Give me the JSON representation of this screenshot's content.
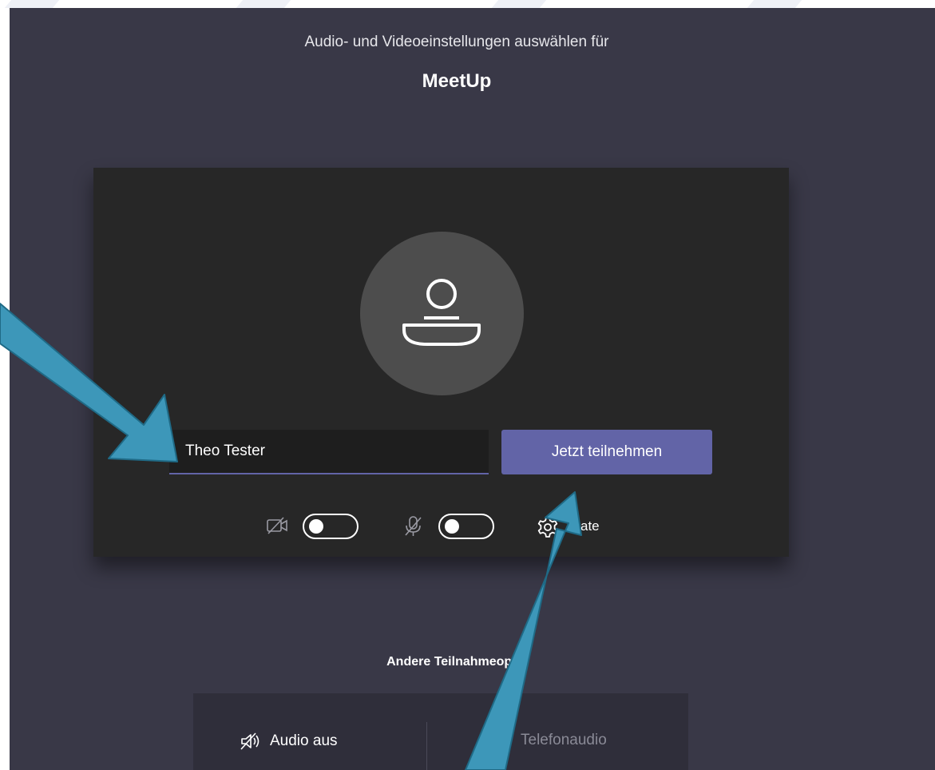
{
  "header": {
    "subtitle": "Audio- und Videoeinstellungen auswählen für",
    "meeting_name": "MeetUp"
  },
  "prejoin": {
    "name_value": "Theo Tester",
    "join_label": "Jetzt teilnehmen",
    "video_toggle": "off",
    "mic_toggle": "off",
    "devices_label": "Geräte",
    "devices_label_visible": "ate"
  },
  "other_options": {
    "title": "Andere Teilnahmeoptionen",
    "title_visible": "Andere Teilnahmeoptic",
    "audio_off_label": "Audio aus",
    "phone_audio_label": "Telefonaudio"
  },
  "icons": [
    "video-off-icon",
    "mic-off-icon",
    "gear-icon",
    "person-icon",
    "speaker-off-icon"
  ],
  "colors": {
    "background": "#393847",
    "card": "#272727",
    "accent": "#6264a7",
    "annotation_arrow": "#3d97b9"
  }
}
